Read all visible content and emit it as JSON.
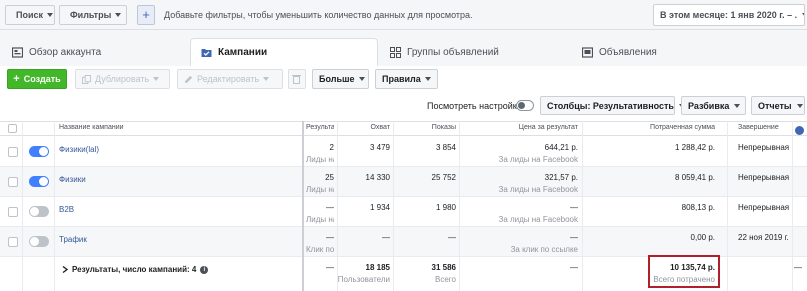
{
  "filter_bar": {
    "search_label": "Поиск",
    "filters_label": "Фильтры",
    "add_filter_symbol": "+",
    "hint": "Добавьте фильтры, чтобы уменьшить количество данных для просмотра.",
    "date_range": "В этом месяце: 1 янв 2020 г. – ."
  },
  "tabs": [
    {
      "label": "Обзор аккаунта",
      "icon": "account-overview-icon",
      "active": false
    },
    {
      "label": "Кампании",
      "icon": "folder-check-icon",
      "active": true
    },
    {
      "label": "Группы объявлений",
      "icon": "grid-icon",
      "active": false
    },
    {
      "label": "Объявления",
      "icon": "ad-icon",
      "active": false
    }
  ],
  "actions": {
    "create": "Создать",
    "duplicate": "Дублировать",
    "edit": "Редактировать",
    "more": "Больше",
    "rules": "Правила"
  },
  "settings": {
    "preview_label": "Посмотреть настройки",
    "columns": "Столбцы: Результативность",
    "breakdown": "Разбивка",
    "reports": "Отчеты"
  },
  "table": {
    "headers": {
      "name": "Название кампании",
      "results": "Результаты",
      "reach": "Охват",
      "impressions": "Показы",
      "cost_per_result": "Цена за результат",
      "amount_spent": "Потраченная сумма",
      "ends": "Завершение"
    },
    "rows": [
      {
        "name": "Физики(lal)",
        "toggle": "on",
        "results": "2",
        "results_sub": "Лиды на F",
        "reach": "3 479",
        "impressions": "3 854",
        "cost": "644,21 р.",
        "cost_sub": "За лиды на Facebook",
        "spent": "1 288,42 р.",
        "ends": "Непрерывная"
      },
      {
        "name": "Физики",
        "toggle": "on",
        "results": "25",
        "results_sub": "Лиды на F",
        "reach": "14 330",
        "impressions": "25 752",
        "cost": "321,57 р.",
        "cost_sub": "За лиды на Facebook",
        "spent": "8 059,41 р.",
        "ends": "Непрерывная"
      },
      {
        "name": "B2B",
        "toggle": "off",
        "results": "—",
        "results_sub": "Лиды на Fa",
        "reach": "1 934",
        "impressions": "1 980",
        "cost": "—",
        "cost_sub": "За лиды на Facebook",
        "spent": "808,13 р.",
        "ends": "Непрерывная"
      },
      {
        "name": "Трафик",
        "toggle": "off",
        "results": "—",
        "results_sub": "Клик по сс",
        "reach": "—",
        "impressions": "—",
        "cost": "—",
        "cost_sub": "За клик по ссылке",
        "spent": "0,00 р.",
        "ends": "22 ноя 2019 г."
      }
    ],
    "summary": {
      "label": "Результаты, число кампаний: 4",
      "results": "—",
      "reach": "18 185",
      "reach_sub": "Пользователи",
      "impressions": "31 586",
      "impressions_sub": "Всего",
      "cost": "—",
      "spent": "10 135,74 р.",
      "spent_sub": "Всего потрачено",
      "ends": "—"
    }
  },
  "colors": {
    "create_green": "#42b72a",
    "link_blue": "#365899",
    "toggle_on": "#4080ff",
    "highlight_red": "#b0202a"
  }
}
